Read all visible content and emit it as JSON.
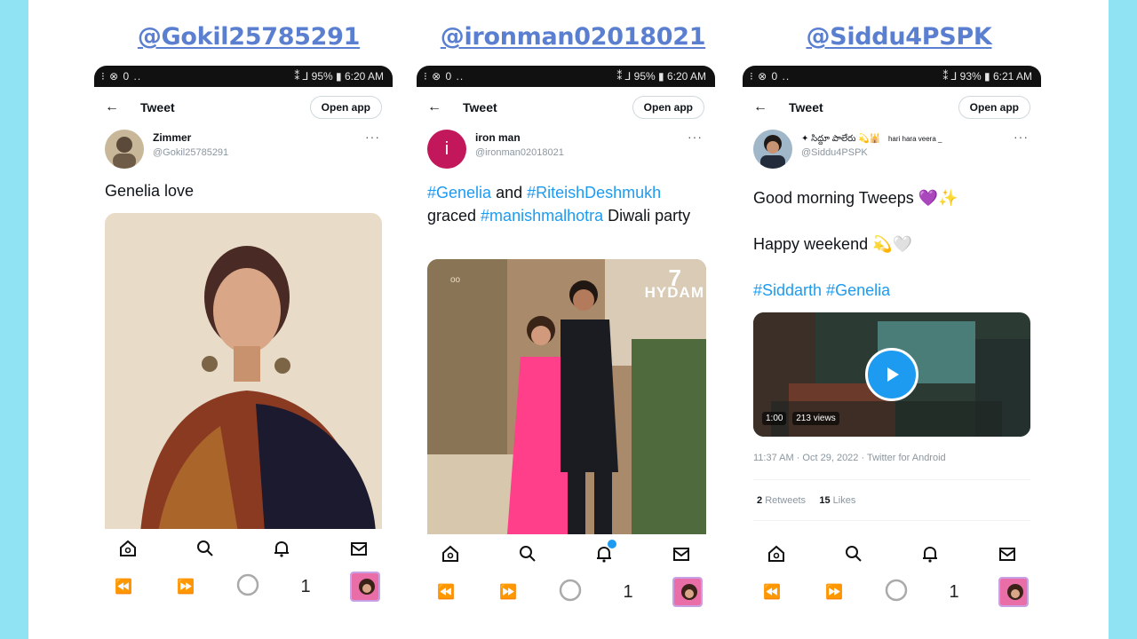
{
  "handles": [
    "@Gokil25785291",
    "@ironman02018021",
    "@Siddu4PSPK"
  ],
  "common": {
    "tweet_header": "Tweet",
    "open_app": "Open app",
    "back_arrow": "←",
    "more": "···",
    "tab_count": "1"
  },
  "phones": [
    {
      "status_left": "⁝ ⊗ 0 ..",
      "status_right": "⁑ ⅃ 95% ▮ 6:20 AM",
      "author_name": "Zimmer",
      "author_username": "@Gokil25785291",
      "text": "Genelia love",
      "notification_badge": false
    },
    {
      "status_left": "⁝ ⊗ 0 ..",
      "status_right": "⁑ ⅃ 95% ▮ 6:20 AM",
      "author_name": "iron man",
      "author_username": "@ironman02018021",
      "avatar_letter": "i",
      "text_parts": [
        "#Genelia",
        " and ",
        "#RiteishDeshmukh",
        " graced ",
        "#manishmalhotra",
        "  Diwali party"
      ],
      "image_watermark": "HYDAM",
      "image_watermark_num": "7",
      "image_sign": "oo",
      "notification_badge": true
    },
    {
      "status_left": "⁝ ⊗ 0 ..",
      "status_right": "⁑ ⅃ 93% ▮ 6:21 AM",
      "author_name": "✦ సిద్దూ పాలేరు 💫🕌",
      "author_name_tail": "hari hara veera _",
      "author_username": "@Siddu4PSPK",
      "line1": "Good morning Tweeps 💜✨",
      "line2": "Happy weekend 💫🤍",
      "hashtags": "#Siddarth #Genelia",
      "video_duration": "1:00",
      "video_views": "213 views",
      "timestamp": "11:37 AM · Oct 29, 2022 · Twitter for Android",
      "retweets_count": "2",
      "retweets_label": "Retweets",
      "likes_count": "15",
      "likes_label": "Likes",
      "notification_badge": false
    }
  ],
  "colors": {
    "background": "#8fe3f3",
    "handle": "#5b7fd0",
    "hashtag": "#1d9bf0",
    "play": "#1d9bf0"
  }
}
